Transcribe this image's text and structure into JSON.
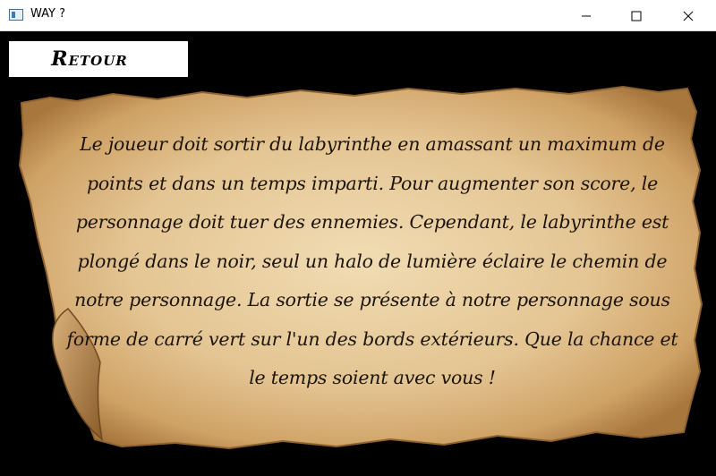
{
  "window": {
    "title": "WAY ?",
    "icons": {
      "app": "app-window-icon",
      "minimize": "minimize-icon",
      "maximize": "maximize-icon",
      "close": "close-icon"
    }
  },
  "toolbar": {
    "back_label": "Retour"
  },
  "rules": {
    "text": "Le joueur doit sortir du labyrinthe en amassant un maximum de points et dans un temps imparti. Pour augmenter son score, le personnage doit tuer des ennemies. Cependant, le labyrinthe est plongé dans le noir, seul un halo de lumière éclaire le chemin de notre personnage. La sortie se présente à notre personnage sous forme de carré vert sur l'un des bords extérieurs. Que la chance et le temps soient avec vous !"
  },
  "colors": {
    "background": "#000000",
    "parchment": "#e6c99a",
    "parchment_edge": "#b98a4e",
    "text": "#1c140a"
  }
}
